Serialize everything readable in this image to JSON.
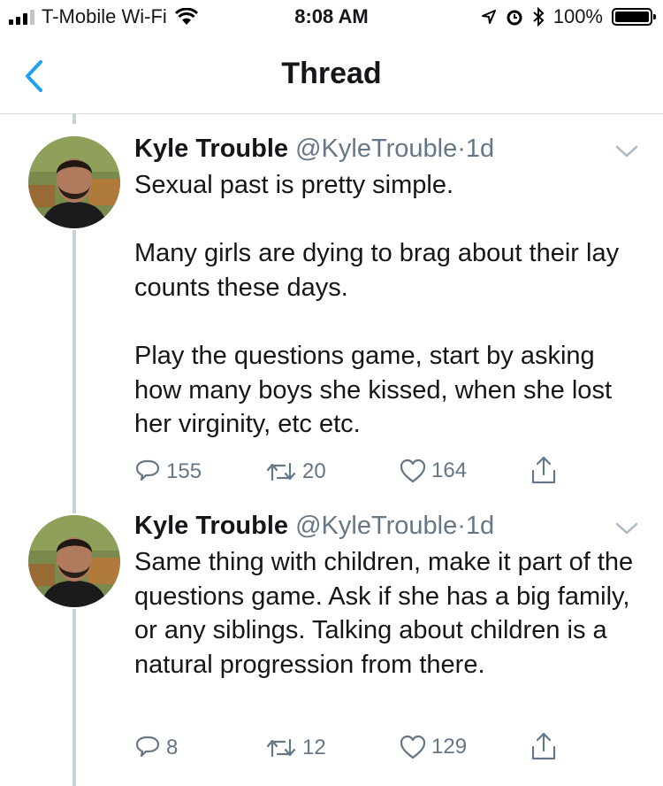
{
  "status_bar": {
    "carrier": "T-Mobile Wi-Fi",
    "time": "8:08 AM",
    "battery": "100%"
  },
  "nav": {
    "title": "Thread"
  },
  "tweets": [
    {
      "name": "Kyle Trouble",
      "handle": "@KyleTrouble",
      "separator": "·",
      "time": "1d",
      "text": "Sexual past is pretty simple.\n\nMany girls are dying to brag about their lay counts these days.\n\nPlay the questions game, start by asking how many boys she kissed, when she lost her virginity, etc etc.",
      "replies": "155",
      "retweets": "20",
      "likes": "164"
    },
    {
      "name": "Kyle Trouble",
      "handle": "@KyleTrouble",
      "separator": "·",
      "time": "1d",
      "text": "Same thing with children, make it part of the questions game. Ask if she has a big family, or any siblings. Talking about children is a natural progression from there.",
      "replies": "8",
      "retweets": "12",
      "likes": "129"
    }
  ],
  "icons": {
    "back": "chevron-left-icon",
    "menu": "chevron-down-icon",
    "reply": "reply-icon",
    "retweet": "retweet-icon",
    "like": "heart-icon",
    "share": "share-icon"
  },
  "colors": {
    "accent": "#1da1f2",
    "secondary_text": "#657786",
    "thread_line": "#c8d0d8"
  }
}
